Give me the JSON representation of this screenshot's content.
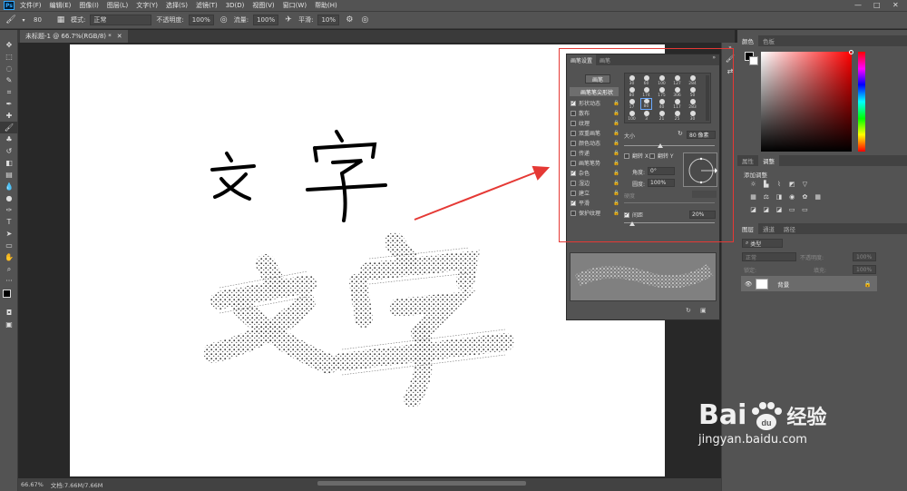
{
  "app": {
    "icon_text": "Ps",
    "window_controls": [
      "—",
      "□",
      "✕"
    ]
  },
  "menu": [
    "文件(F)",
    "编辑(E)",
    "图像(I)",
    "图层(L)",
    "文字(Y)",
    "选择(S)",
    "滤镜(T)",
    "3D(D)",
    "视图(V)",
    "窗口(W)",
    "帮助(H)"
  ],
  "options": {
    "brush_size": "80",
    "mode_label": "模式:",
    "mode_value": "正常",
    "opacity_label": "不透明度:",
    "opacity_value": "100%",
    "flow_label": "流量:",
    "flow_value": "100%",
    "smooth_label": "平滑:",
    "smooth_value": "10%"
  },
  "document": {
    "tab_title": "未标题-1 @ 66.7%(RGB/8) *"
  },
  "status": {
    "zoom": "66.67%",
    "doc_info": "文档:7.66M/7.66M"
  },
  "canvas_text": {
    "top_word": "文 字",
    "brush_word": "文字"
  },
  "brush_panel": {
    "tabs": [
      "画笔设置",
      "画笔"
    ],
    "preset_button": "画笔",
    "options": [
      {
        "label": "画笔笔尖形状",
        "checked": null,
        "selected": true
      },
      {
        "label": "形状动态",
        "checked": true
      },
      {
        "label": "散布",
        "checked": false
      },
      {
        "label": "纹理",
        "checked": false
      },
      {
        "label": "双重画笔",
        "checked": false
      },
      {
        "label": "颜色动态",
        "checked": false
      },
      {
        "label": "传递",
        "checked": false
      },
      {
        "label": "画笔笔势",
        "checked": false
      },
      {
        "label": "杂色",
        "checked": true
      },
      {
        "label": "湿边",
        "checked": false
      },
      {
        "label": "建立",
        "checked": false
      },
      {
        "label": "平滑",
        "checked": true
      },
      {
        "label": "保护纹理",
        "checked": false
      }
    ],
    "tip_sizes": [
      "30",
      "60",
      "100",
      "127",
      "284",
      "80",
      "174",
      "175",
      "306",
      "50",
      "17",
      "80",
      "40",
      "117",
      "283",
      "100",
      "3",
      "21",
      "25",
      "30"
    ],
    "size_label": "大小",
    "size_value": "80 像素",
    "flip_x": "翻转 X",
    "flip_y": "翻转 Y",
    "angle_label": "角度:",
    "angle_value": "0°",
    "roundness_label": "圆度:",
    "roundness_value": "100%",
    "hardness_label": "硬度",
    "spacing_label": "间距",
    "spacing_value": "20%"
  },
  "right_panels": {
    "color_tabs": [
      "颜色",
      "色板"
    ],
    "adjust_tabs": [
      "属性",
      "调整"
    ],
    "adjust_title": "添加调整",
    "layer_tabs": [
      "图层",
      "通道",
      "路径"
    ],
    "layer_filter": "类型",
    "blend_mode": "正常",
    "layer_opacity_label": "不透明度:",
    "layer_opacity": "100%",
    "lock_label": "锁定:",
    "fill_label": "填充:",
    "fill_value": "100%",
    "layer_name": "背景"
  },
  "watermark": {
    "brand": "Bai",
    "brand2": "经验",
    "url": "jingyan.baidu.com"
  }
}
